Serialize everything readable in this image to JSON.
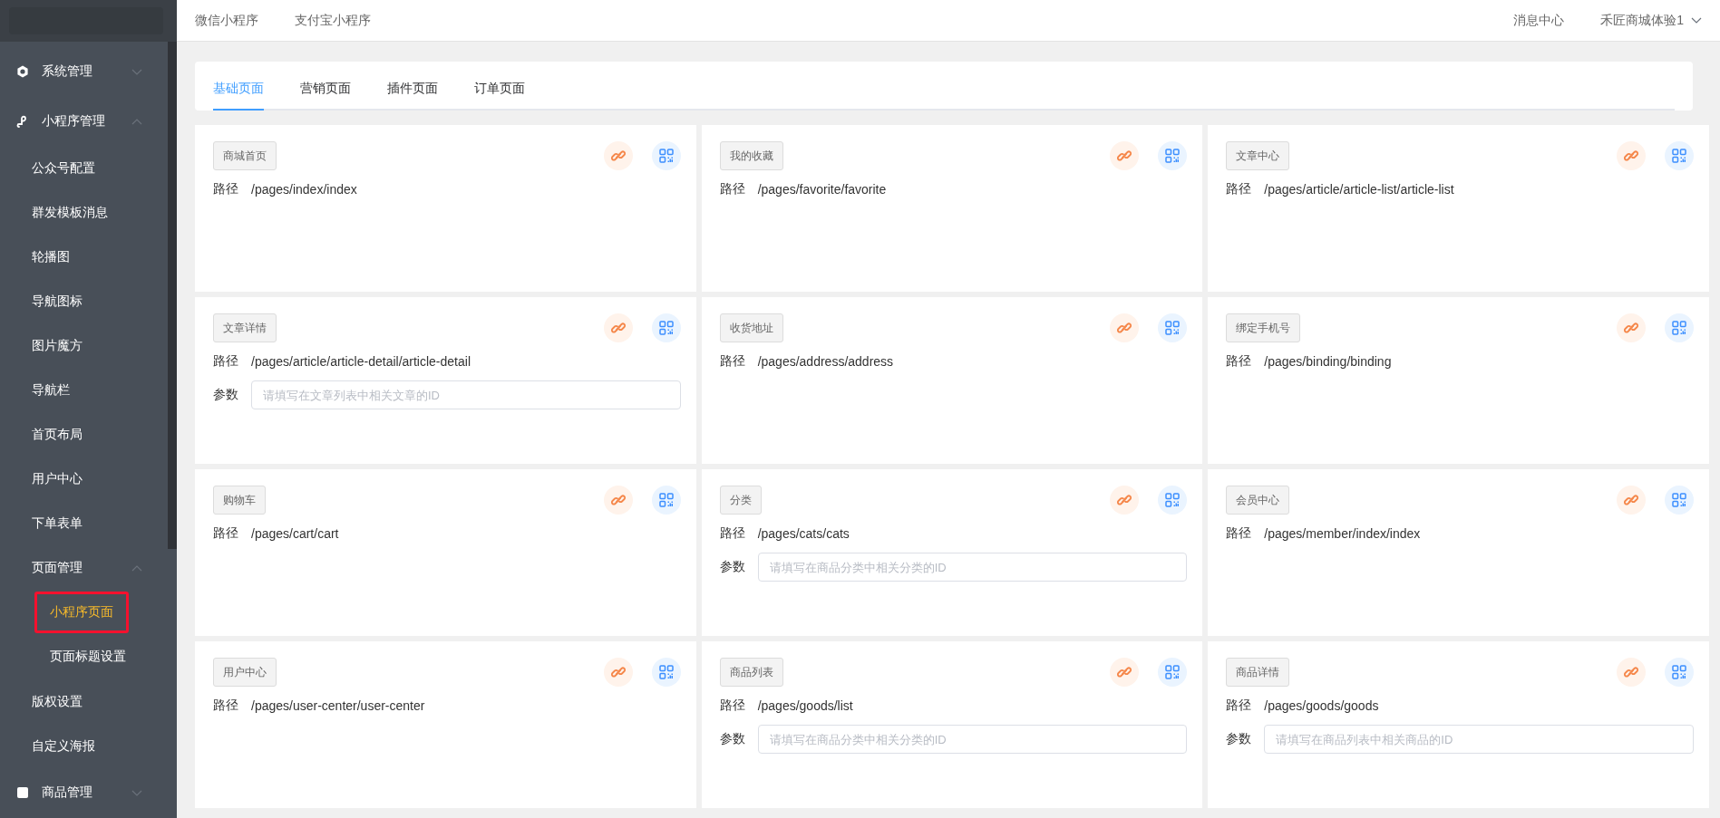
{
  "top_bar": {
    "platform_links": [
      {
        "label": "微信小程序"
      },
      {
        "label": "支付宝小程序"
      }
    ],
    "message_center": "消息中心",
    "user_menu": "禾匠商城体验1"
  },
  "sidebar": {
    "items": [
      {
        "label": "系统管理",
        "expanded": false
      },
      {
        "label": "小程序管理",
        "expanded": true,
        "children": [
          {
            "label": "公众号配置",
            "selected": false
          },
          {
            "label": "群发模板消息",
            "selected": false
          },
          {
            "label": "轮播图",
            "selected": false
          },
          {
            "label": "导航图标",
            "selected": false
          },
          {
            "label": "图片魔方",
            "selected": false
          },
          {
            "label": "导航栏",
            "selected": false
          },
          {
            "label": "首页布局",
            "selected": false
          },
          {
            "label": "用户中心",
            "selected": false
          },
          {
            "label": "下单表单",
            "selected": false
          },
          {
            "label": "页面管理",
            "expanded": true,
            "children": [
              {
                "label": "小程序页面",
                "selected": true
              },
              {
                "label": "页面标题设置",
                "selected": false
              }
            ]
          },
          {
            "label": "版权设置",
            "selected": false
          },
          {
            "label": "自定义海报",
            "selected": false
          }
        ]
      },
      {
        "label": "商品管理",
        "expanded": false
      }
    ]
  },
  "tabs": [
    {
      "label": "基础页面",
      "selected": true
    },
    {
      "label": "营销页面",
      "selected": false
    },
    {
      "label": "插件页面",
      "selected": false
    },
    {
      "label": "订单页面",
      "selected": false
    }
  ],
  "cards": [
    {
      "title": "商城首页",
      "path_label": "路径",
      "path": "/pages/index/index"
    },
    {
      "title": "我的收藏",
      "path_label": "路径",
      "path": "/pages/favorite/favorite"
    },
    {
      "title": "文章中心",
      "path_label": "路径",
      "path": "/pages/article/article-list/article-list"
    },
    {
      "title": "文章详情",
      "path_label": "路径",
      "path": "/pages/article/article-detail/article-detail",
      "param": {
        "label": "参数",
        "placeholder": "请填写在文章列表中相关文章的ID"
      }
    },
    {
      "title": "收货地址",
      "path_label": "路径",
      "path": "/pages/address/address"
    },
    {
      "title": "绑定手机号",
      "path_label": "路径",
      "path": "/pages/binding/binding"
    },
    {
      "title": "购物车",
      "path_label": "路径",
      "path": "/pages/cart/cart"
    },
    {
      "title": "分类",
      "path_label": "路径",
      "path": "/pages/cats/cats",
      "param": {
        "label": "参数",
        "placeholder": "请填写在商品分类中相关分类的ID"
      }
    },
    {
      "title": "会员中心",
      "path_label": "路径",
      "path": "/pages/member/index/index"
    },
    {
      "title": "用户中心",
      "path_label": "路径",
      "path": "/pages/user-center/user-center"
    },
    {
      "title": "商品列表",
      "path_label": "路径",
      "path": "/pages/goods/list",
      "param": {
        "label": "参数",
        "placeholder": "请填写在商品分类中相关分类的ID"
      }
    },
    {
      "title": "商品详情",
      "path_label": "路径",
      "path": "/pages/goods/goods",
      "param": {
        "label": "参数",
        "placeholder": "请填写在商品列表中相关商品的ID"
      }
    }
  ]
}
